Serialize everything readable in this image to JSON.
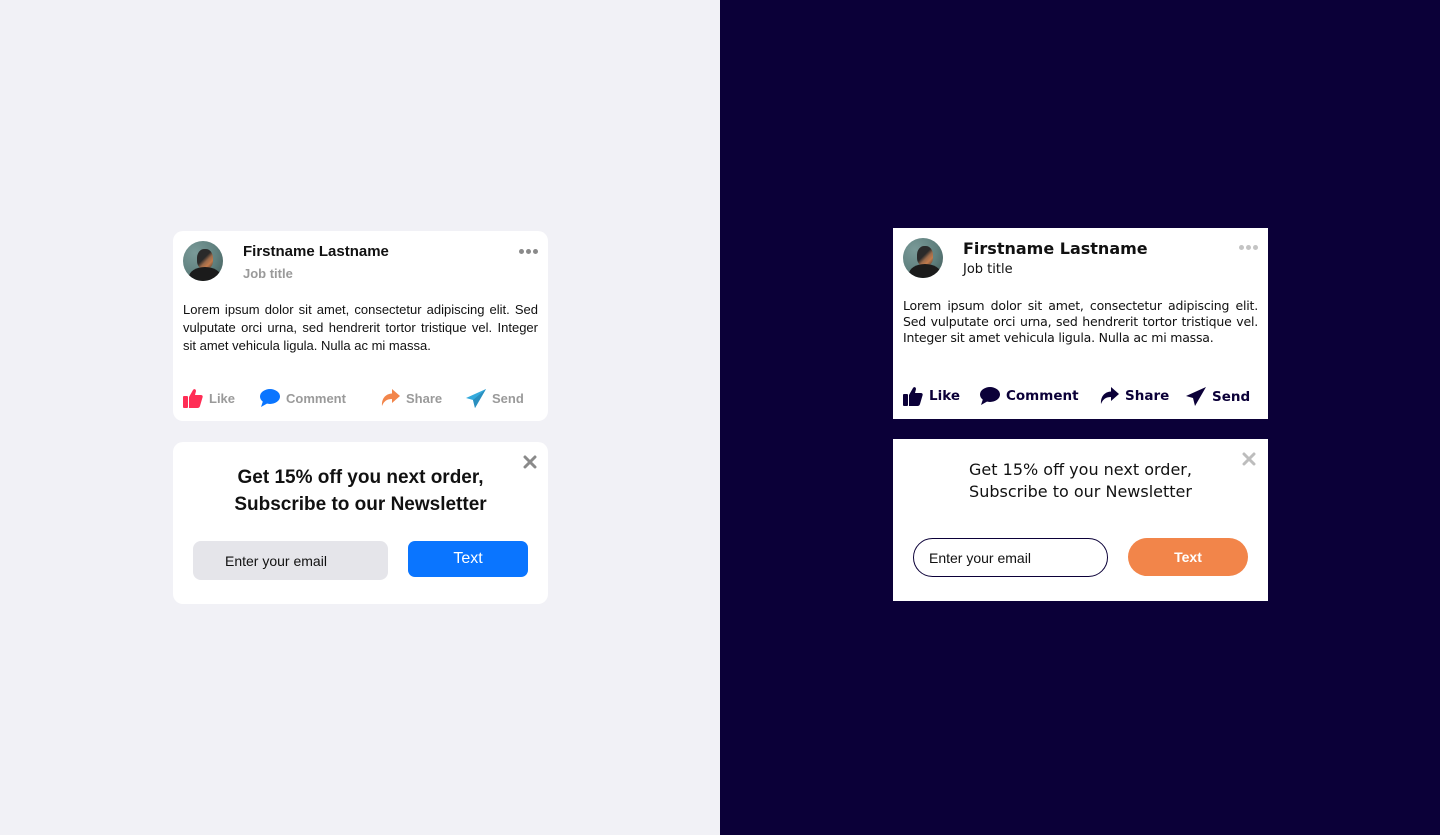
{
  "colors": {
    "left_background": "#f1f1f6",
    "right_background": "#0b0038",
    "like": "#ff2d55",
    "comment": "#0a75ff",
    "share": "#f2854a",
    "send": "#34aadc",
    "primary_button": "#0a75ff",
    "accent_button": "#f2854a",
    "dark_icon": "#0b0038"
  },
  "light_theme": {
    "post": {
      "name": "Firstname Lastname",
      "job_title": "Job title",
      "body": "Lorem ipsum dolor sit amet, consectetur adipiscing elit. Sed vulputate orci urna, sed hendrerit tortor tristique vel. Integer sit amet vehicula ligula. Nulla ac mi massa.",
      "actions": [
        {
          "label": "Like",
          "icon": "thumbs-up-icon"
        },
        {
          "label": "Comment",
          "icon": "speech-bubble-icon"
        },
        {
          "label": "Share",
          "icon": "share-arrow-icon"
        },
        {
          "label": "Send",
          "icon": "paper-plane-icon"
        }
      ]
    },
    "newsletter": {
      "headline_line1": "Get 15% off you next order,",
      "headline_line2": "Subscribe to our Newsletter",
      "email_placeholder": "Enter your email",
      "button_label": "Text"
    }
  },
  "dark_theme": {
    "post": {
      "name": "Firstname Lastname",
      "job_title": "Job title",
      "body": "Lorem ipsum dolor sit amet, consectetur adipiscing elit. Sed vulputate orci urna, sed hendrerit tortor tristique vel. Integer sit amet vehicula ligula. Nulla ac mi massa.",
      "actions": [
        {
          "label": "Like",
          "icon": "thumbs-up-icon"
        },
        {
          "label": "Comment",
          "icon": "speech-bubble-icon"
        },
        {
          "label": "Share",
          "icon": "share-arrow-icon"
        },
        {
          "label": "Send",
          "icon": "paper-plane-icon"
        }
      ]
    },
    "newsletter": {
      "headline_line1": "Get 15% off you next order,",
      "headline_line2": "Subscribe to our Newsletter",
      "email_placeholder": "Enter your email",
      "button_label": "Text"
    }
  }
}
